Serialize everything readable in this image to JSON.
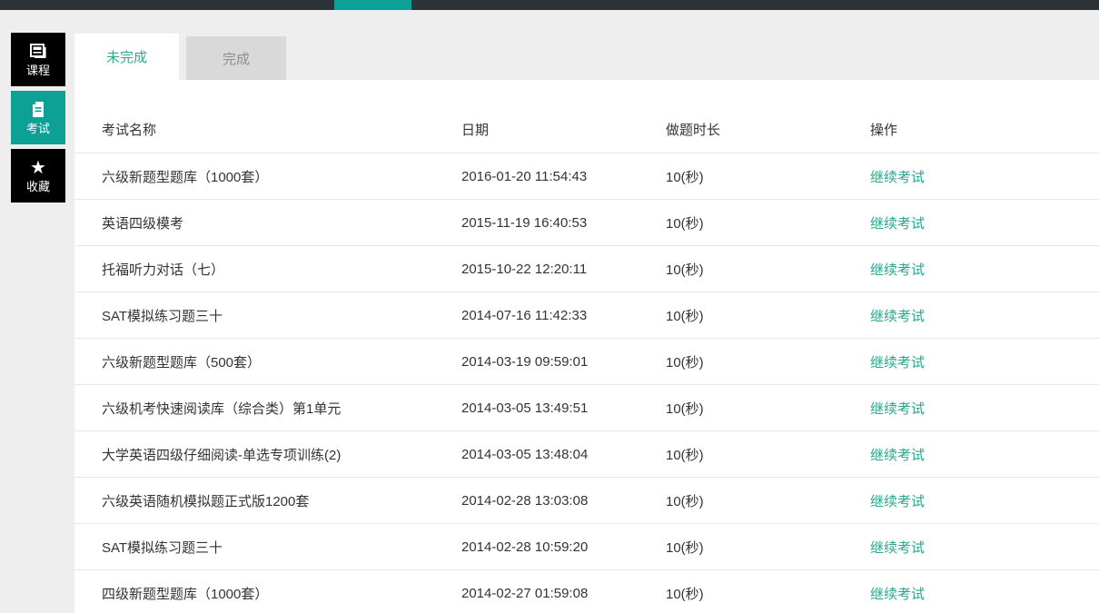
{
  "topbar": {
    "accent_color": "#0da195",
    "bar_color": "#2d3237"
  },
  "sidebar": {
    "items": [
      {
        "label": "课程",
        "icon": "journal-icon",
        "active": false
      },
      {
        "label": "考试",
        "icon": "exam-file-icon",
        "active": true
      },
      {
        "label": "收藏",
        "icon": "star-icon",
        "active": false
      }
    ]
  },
  "tabs": {
    "items": [
      {
        "label": "未完成",
        "active": true
      },
      {
        "label": "完成",
        "active": false
      }
    ]
  },
  "table": {
    "headers": {
      "name": "考试名称",
      "date": "日期",
      "duration": "做题时长",
      "action": "操作"
    },
    "rows": [
      {
        "name": "六级新题型题库（1000套）",
        "date": "2016-01-20 11:54:43",
        "duration": "10(秒)",
        "action": "继续考试"
      },
      {
        "name": "英语四级模考",
        "date": "2015-11-19 16:40:53",
        "duration": "10(秒)",
        "action": "继续考试"
      },
      {
        "name": "托福听力对话（七）",
        "date": "2015-10-22 12:20:11",
        "duration": "10(秒)",
        "action": "继续考试"
      },
      {
        "name": "SAT模拟练习题三十",
        "date": "2014-07-16 11:42:33",
        "duration": "10(秒)",
        "action": "继续考试"
      },
      {
        "name": "六级新题型题库（500套）",
        "date": "2014-03-19 09:59:01",
        "duration": "10(秒)",
        "action": "继续考试"
      },
      {
        "name": "六级机考快速阅读库（综合类）第1单元",
        "date": "2014-03-05 13:49:51",
        "duration": "10(秒)",
        "action": "继续考试"
      },
      {
        "name": "大学英语四级仔细阅读-单选专项训练(2)",
        "date": "2014-03-05 13:48:04",
        "duration": "10(秒)",
        "action": "继续考试"
      },
      {
        "name": "六级英语随机模拟题正式版1200套",
        "date": "2014-02-28 13:03:08",
        "duration": "10(秒)",
        "action": "继续考试"
      },
      {
        "name": "SAT模拟练习题三十",
        "date": "2014-02-28 10:59:20",
        "duration": "10(秒)",
        "action": "继续考试"
      },
      {
        "name": "四级新题型题库（1000套）",
        "date": "2014-02-27 01:59:08",
        "duration": "10(秒)",
        "action": "继续考试"
      }
    ]
  }
}
